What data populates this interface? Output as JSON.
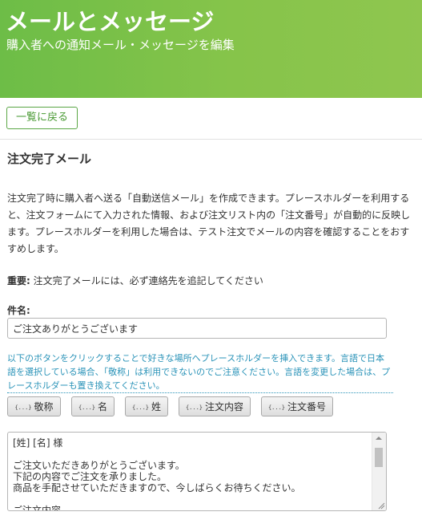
{
  "header": {
    "title": "メールとメッセージ",
    "subtitle": "購入者への通知メール・メッセージを編集"
  },
  "toolbar": {
    "back_label": "一覧に戻る"
  },
  "section": {
    "title": "注文完了メール",
    "description": "注文完了時に購入者へ送る「自動送信メール」を作成できます。プレースホルダーを利用すると、注文フォームにて入力された情報、および注文リスト内の「注文番号」が自動的に反映します。プレースホルダーを利用した場合は、テスト注文でメールの内容を確認することをおすすめします。",
    "important_label": "重要:",
    "important_text": " 注文完了メールには、必ず連絡先を追記してください"
  },
  "subject": {
    "label": "件名:",
    "value": "ご注文ありがとうございます"
  },
  "hint": "以下のボタンをクリックすることで好きな場所へプレースホルダーを挿入できます。言語で日本語を選択している場合、「敬称」は利用できないのでご注意ください。言語を変更した場合は、プレースホルダーも置き換えてください。",
  "placeholder_buttons": [
    {
      "icon": "{...}",
      "label": "敬称"
    },
    {
      "icon": "{...}",
      "label": "名"
    },
    {
      "icon": "{...}",
      "label": "姓"
    },
    {
      "icon": "{...}",
      "label": "注文内容"
    },
    {
      "icon": "{...}",
      "label": "注文番号"
    }
  ],
  "body": {
    "text": "[姓] [名] 様\n\nご注文いただきありがとうございます。\n下記の内容でご注文を承りました。\n商品を手配させていただきますので、今しばらくお待ちください。\n\nご注文内容"
  },
  "colors": {
    "header_green": "#7ac04a",
    "accent_green": "#5aa645",
    "hint_blue": "#2a93b8"
  }
}
